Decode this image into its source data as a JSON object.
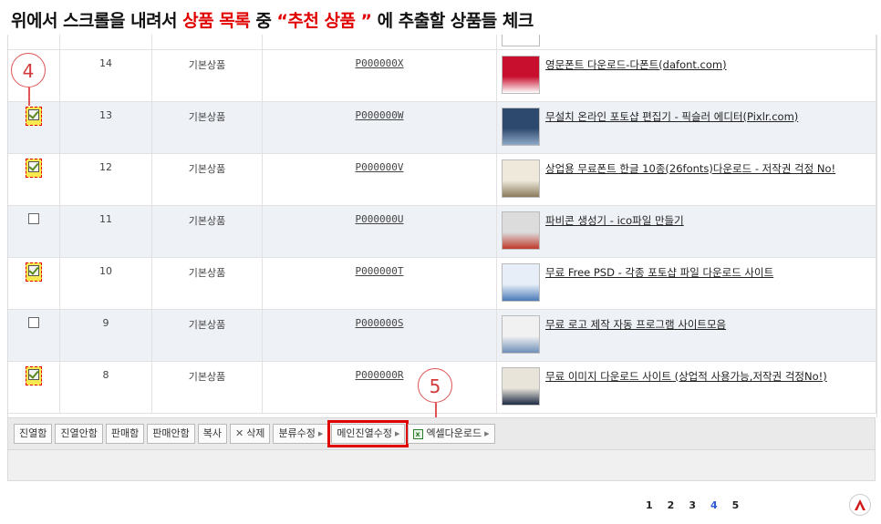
{
  "instruction": {
    "part1": "위에서 스크롤을 내려서 ",
    "part2": "상품 목록",
    "part3": " 중 ",
    "part4": "“추천 상품 ”",
    "part5": " 에 추출할 상품들 체크"
  },
  "rows": [
    {
      "no": "14",
      "type": "기본상품",
      "code": "P000000X",
      "name": "영문폰트 다운로드-다폰트(dafont.com)",
      "checked": false
    },
    {
      "no": "13",
      "type": "기본상품",
      "code": "P000000W",
      "name": "무설치 온라인 포토샵 편집기 - 픽슬러 에디터(Pixlr.com)",
      "checked": true
    },
    {
      "no": "12",
      "type": "기본상품",
      "code": "P000000V",
      "name": "상업용 무료폰트 한글 10종(26fonts)다운로드 - 저작권 걱정 No!",
      "checked": true
    },
    {
      "no": "11",
      "type": "기본상품",
      "code": "P000000U",
      "name": "파비콘 생성기 - ico파일 만들기",
      "checked": false
    },
    {
      "no": "10",
      "type": "기본상품",
      "code": "P000000T",
      "name": "무료 Free PSD - 각종 포토샵 파일 다운로드 사이트",
      "checked": true
    },
    {
      "no": "9",
      "type": "기본상품",
      "code": "P000000S",
      "name": "무료 로고 제작 자동 프로그램 사이트모음",
      "checked": false
    },
    {
      "no": "8",
      "type": "기본상품",
      "code": "P000000R",
      "name": "무료 이미지 다운로드 사이트 (상업적 사용가능,저작권 걱정No!)",
      "checked": true
    }
  ],
  "callouts": {
    "step4": "4",
    "step5": "5"
  },
  "toolbar": {
    "display": "진열함",
    "no_display": "진열안함",
    "sell": "판매함",
    "no_sell": "판매안함",
    "copy": "복사",
    "delete": "삭제",
    "category_edit": "분류수정",
    "main_display_edit": "메인진열수정",
    "excel_download": "엑셀다운로드"
  },
  "pagination": [
    "1",
    "2",
    "3",
    "4",
    "5"
  ],
  "pagination_active": "4",
  "colors": {
    "accent_red": "#e00000",
    "active_page": "#2c5bd8",
    "check_highlight": "#f7e94f"
  }
}
